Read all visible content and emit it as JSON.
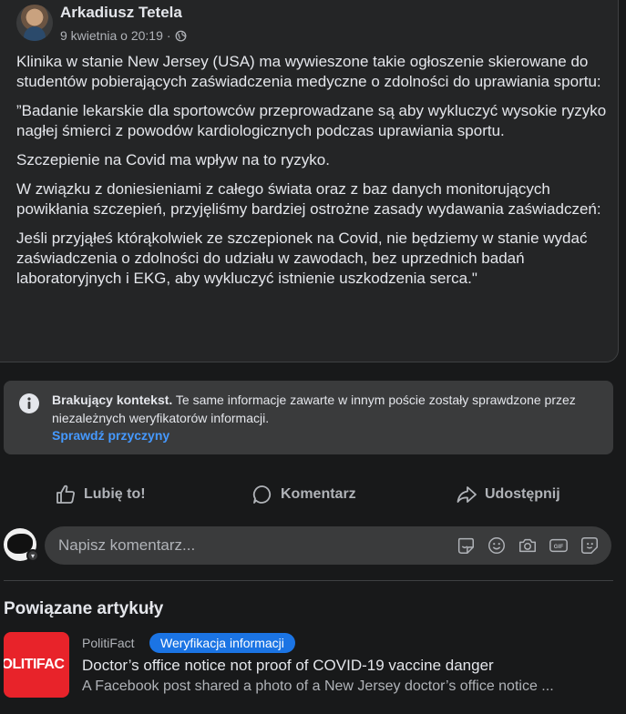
{
  "post": {
    "author": "Arkadiusz Tetela",
    "timestamp": "9 kwietnia o 20:19",
    "separator": "·",
    "privacy_icon": "globe-icon",
    "paragraphs": [
      "Klinika w stanie New Jersey (USA) ma wywieszone takie ogłoszenie skierowane do studentów pobierających zaświadczenia medyczne o zdolności do uprawiania sportu:",
      "”Badanie lekarskie dla sportowców przeprowadzane są aby wykluczyć wysokie ryzyko nagłej śmierci z powodów kardiologicznych podczas uprawiania sportu.",
      "Szczepienie na Covid ma wpływ na to ryzyko.",
      "W związku z doniesieniami z całego świata oraz z baz danych monitorujących powikłania szczepień, przyjęliśmy bardziej ostrożne zasady wydawania zaświadczeń:",
      "Jeśli przyjąłeś którąkolwiek ze szczepionek na Covid, nie będziemy w stanie wydać zaświadczenia o zdolności do udziału w zawodach, bez uprzednich badań laboratoryjnych i EKG, aby wykluczyć istnienie uszkodzenia serca.\""
    ]
  },
  "context": {
    "icon": "info-icon",
    "bold": "Brakujący kontekst.",
    "text": " Te same informacje zawarte w innym poście zostały sprawdzone przez niezależnych weryfikatorów informacji.",
    "link": "Sprawdź przyczyny"
  },
  "actions": {
    "like": "Lubię to!",
    "comment": "Komentarz",
    "share": "Udostępnij"
  },
  "comment_box": {
    "placeholder": "Napisz komentarz...",
    "tools": [
      "sticker-icon",
      "emoji-icon",
      "camera-icon",
      "gif-icon",
      "avatar-sticker-icon"
    ],
    "gif_label": "GIF"
  },
  "related": {
    "title": "Powiązane artykuły",
    "article": {
      "thumb_text": "OLITIFAC",
      "source": "PolitiFact",
      "badge": "Weryfikacja informacji",
      "title": "Doctor’s office notice not proof of COVID-19 vaccine danger",
      "snippet": "A Facebook post shared a photo of a New Jersey doctor’s office notice ..."
    }
  },
  "colors": {
    "background": "#18191a",
    "card": "#242526",
    "link": "#4599ff",
    "badge": "#1b74e4",
    "politifact_red": "#e8232a"
  }
}
